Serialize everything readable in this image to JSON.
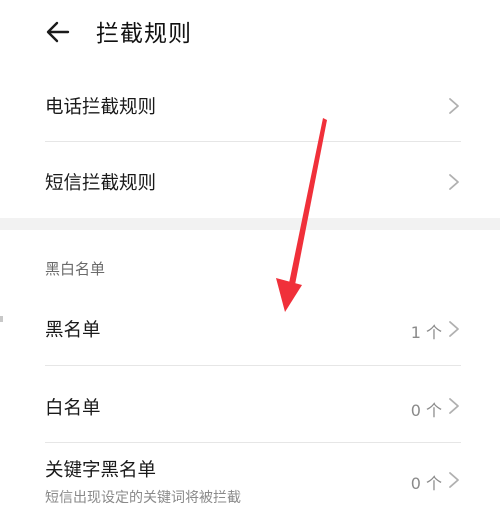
{
  "header": {
    "title": "拦截规则",
    "back_icon": "arrow-left-icon"
  },
  "rules": {
    "call_rules_label": "电话拦截规则",
    "sms_rules_label": "短信拦截规则"
  },
  "lists_section": {
    "title": "黑白名单",
    "blacklist_label": "黑名单",
    "blacklist_count": "1 个",
    "whitelist_label": "白名单",
    "whitelist_count": "0 个",
    "keyword_label": "关键字黑名单",
    "keyword_count": "0 个",
    "keyword_desc": "短信出现设定的关键词将被拦截"
  },
  "colors": {
    "annotation_arrow": "#f0303a",
    "text_primary": "#1a1a1a",
    "text_secondary": "#8a8a8a",
    "divider": "#e6e6e6"
  }
}
